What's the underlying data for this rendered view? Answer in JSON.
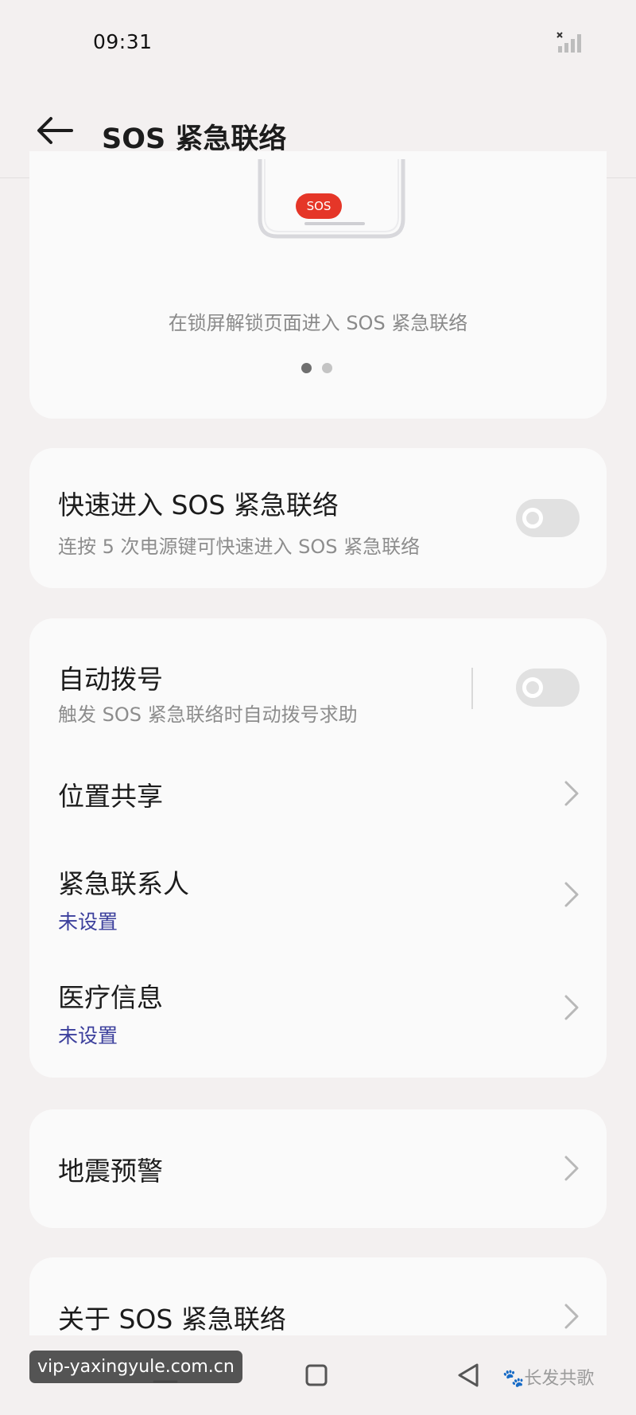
{
  "status_bar": {
    "time": "09:31",
    "signal_icon": "signal-no-service-icon"
  },
  "header": {
    "title": "SOS 紧急联络",
    "back_icon": "arrow-left-icon"
  },
  "hero": {
    "sos_badge": "SOS",
    "caption": "在锁屏解锁页面进入 SOS 紧急联络",
    "pager": {
      "pages": 2,
      "current": 1
    }
  },
  "quick_access": {
    "title": "快速进入 SOS 紧急联络",
    "subtitle": "连按 5 次电源键可快速进入 SOS 紧急联络",
    "enabled": false
  },
  "settings": {
    "auto_dial": {
      "title": "自动拨号",
      "subtitle": "触发 SOS 紧急联络时自动拨号求助",
      "enabled": false
    },
    "location_share": {
      "title": "位置共享"
    },
    "emergency_contacts": {
      "title": "紧急联系人",
      "status": "未设置"
    },
    "medical_info": {
      "title": "医疗信息",
      "status": "未设置"
    }
  },
  "earthquake": {
    "title": "地震预警"
  },
  "about": {
    "title": "关于 SOS 紧急联络"
  },
  "navigation": {
    "home_icon": "square-home-icon",
    "back_icon": "triangle-back-icon",
    "menu_icon": "menu-icon"
  },
  "watermarks": {
    "left": "vip-yaxingyule.com.cn",
    "right": "长发共歌"
  },
  "colors": {
    "accent_status": "#3b3f9c",
    "sos_red": "#e53628",
    "background": "#f3f0f0",
    "card": "#fafafa"
  }
}
